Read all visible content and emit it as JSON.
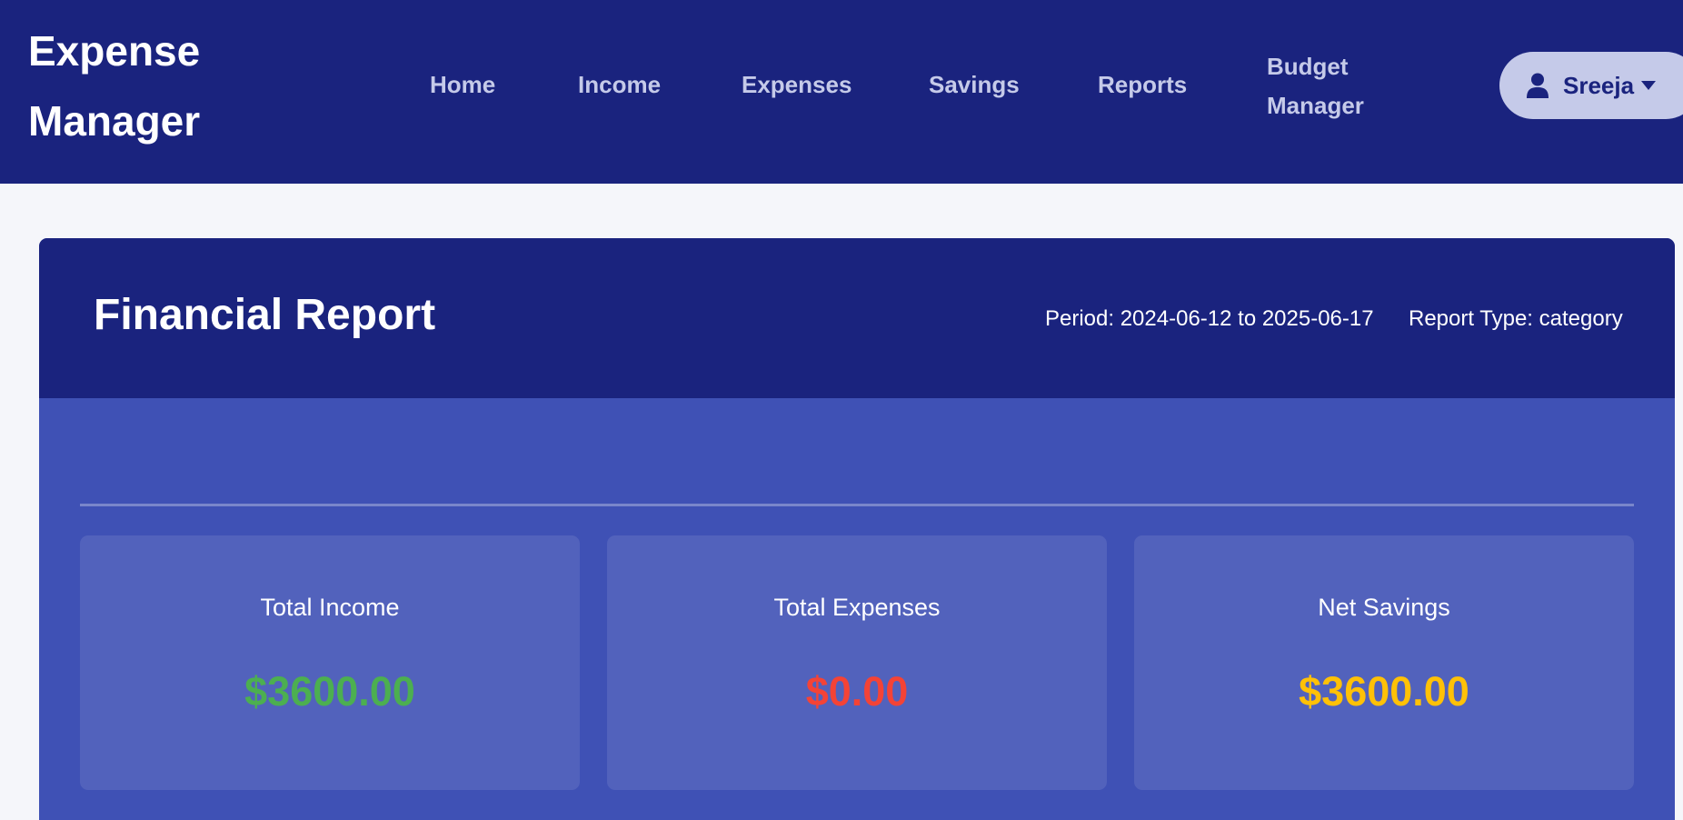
{
  "navbar": {
    "brand": "Expense Manager",
    "links": {
      "home": "Home",
      "income": "Income",
      "expenses": "Expenses",
      "savings": "Savings",
      "reports": "Reports",
      "budget_manager": "Budget Manager"
    },
    "user": {
      "name": "Sreeja",
      "icon": "user-icon",
      "dropdown_icon": "caret-down-icon"
    }
  },
  "report": {
    "title": "Financial Report",
    "period": "Period: 2024-06-12 to 2025-06-17",
    "report_type": "Report Type: category"
  },
  "summary": {
    "income": {
      "label": "Total Income",
      "value": "$3600.00"
    },
    "expenses": {
      "label": "Total Expenses",
      "value": "$0.00"
    },
    "savings": {
      "label": "Net Savings",
      "value": "$3600.00"
    }
  },
  "colors": {
    "navbar_bg": "#1a237e",
    "nav_link": "#c5cae9",
    "report_body_bg": "#3f51b5",
    "summary_box_bg": "#5262bc",
    "income_value": "#4caf50",
    "expense_value": "#f44336",
    "savings_value": "#ffc107"
  }
}
